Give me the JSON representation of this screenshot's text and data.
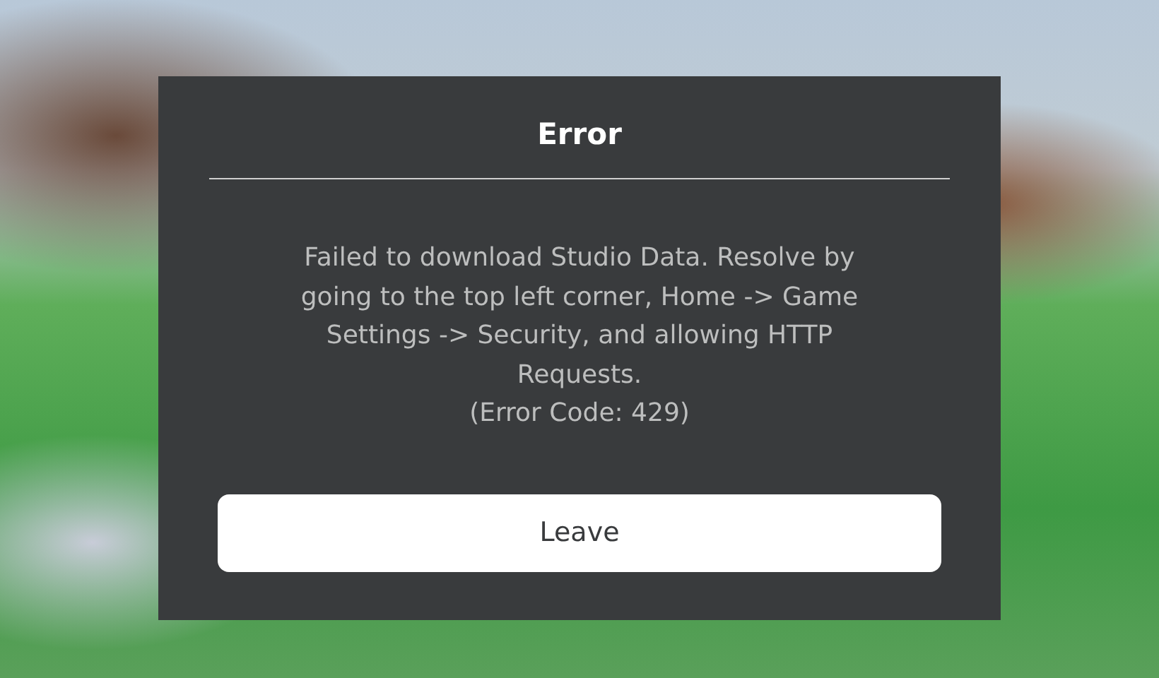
{
  "dialog": {
    "title": "Error",
    "message": "Failed to download Studio Data. Resolve by going to the top left corner, Home -> Game Settings -> Security, and allowing HTTP Requests.",
    "error_code": "(Error Code: 429)",
    "buttons": [
      "Leave"
    ]
  }
}
